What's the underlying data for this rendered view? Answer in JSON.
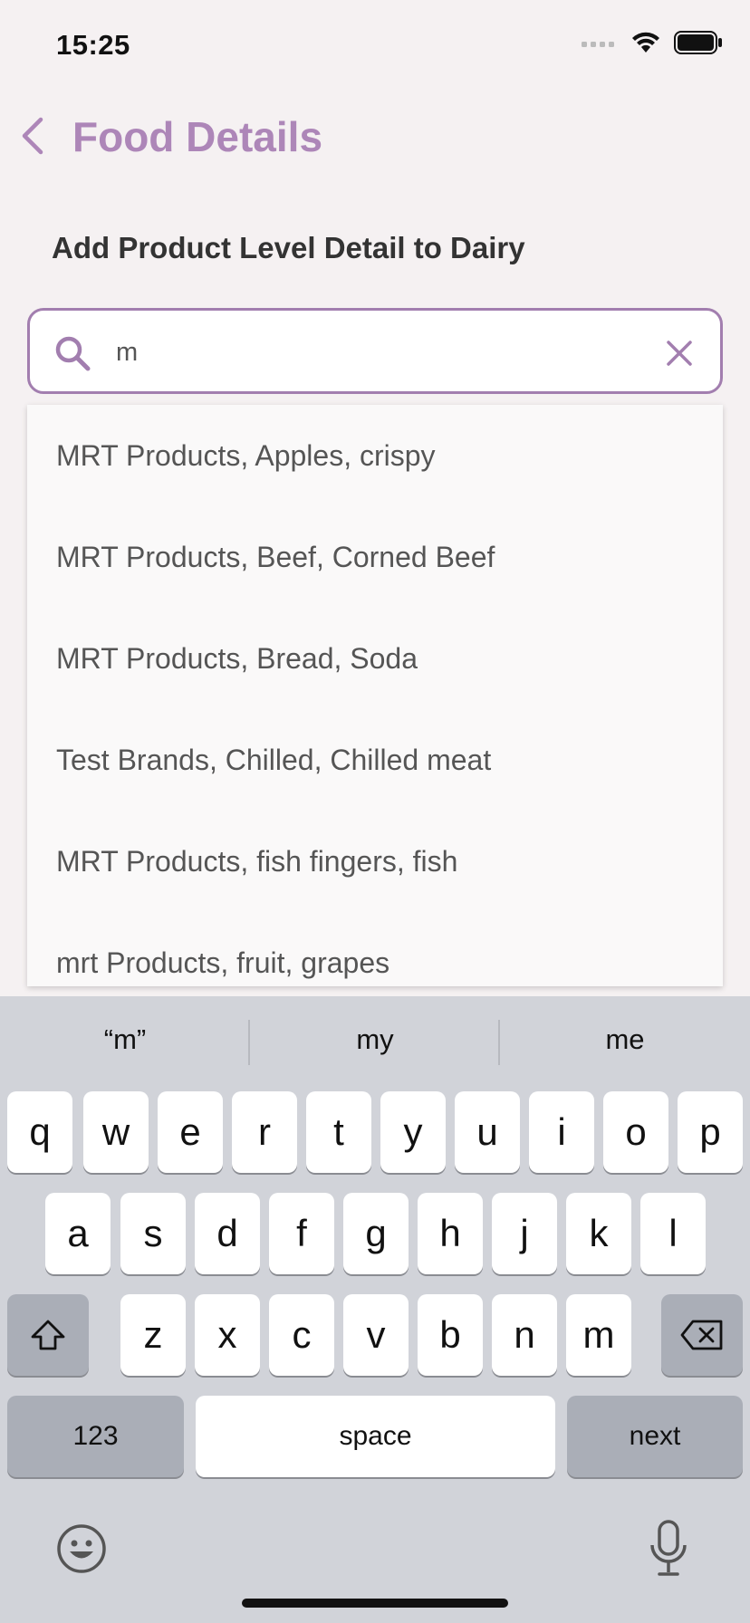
{
  "status_bar": {
    "time": "15:25"
  },
  "header": {
    "title": "Food Details"
  },
  "section": {
    "title": "Add Product Level Detail to Dairy"
  },
  "search": {
    "value": "m"
  },
  "dropdown": {
    "options": [
      "MRT Products, Apples, crispy",
      "MRT Products, Beef, Corned Beef",
      "MRT Products, Bread, Soda",
      "Test Brands, Chilled, Chilled meat",
      "MRT Products, fish fingers, fish",
      "mrt Products, fruit, grapes"
    ]
  },
  "keyboard": {
    "suggestions": [
      "“m”",
      "my",
      "me"
    ],
    "row1": [
      "q",
      "w",
      "e",
      "r",
      "t",
      "y",
      "u",
      "i",
      "o",
      "p"
    ],
    "row2": [
      "a",
      "s",
      "d",
      "f",
      "g",
      "h",
      "j",
      "k",
      "l"
    ],
    "row3": [
      "z",
      "x",
      "c",
      "v",
      "b",
      "n",
      "m"
    ],
    "numbers_label": "123",
    "space_label": "space",
    "next_label": "next"
  },
  "colors": {
    "accent": "#a27eaf",
    "title": "#ad86b8"
  }
}
